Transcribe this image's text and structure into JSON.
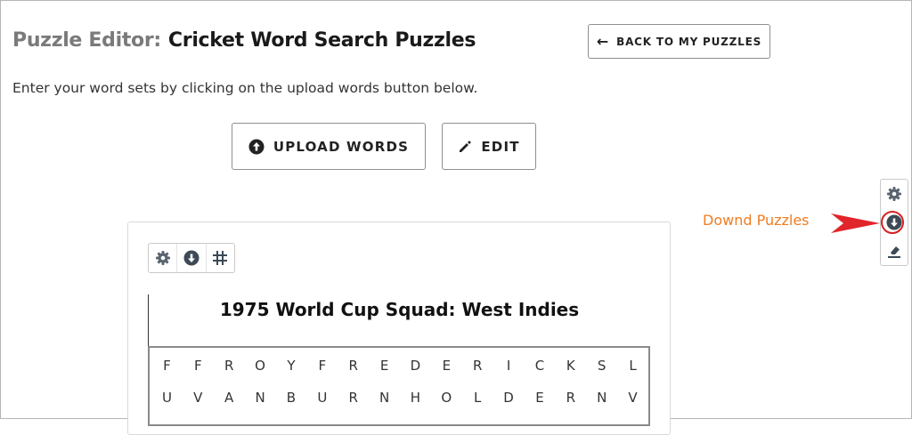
{
  "header": {
    "title_prefix": "Puzzle Editor:",
    "title": "Cricket Word Search Puzzles",
    "back_button": "BACK TO MY PUZZLES"
  },
  "instruction": "Enter your word sets by clicking on the upload words button below.",
  "actions": {
    "upload_label": "UPLOAD WORDS",
    "edit_label": "EDIT"
  },
  "side_toolbar": {
    "icons": [
      "gear-icon",
      "download-icon",
      "eraser-icon"
    ]
  },
  "annotation": {
    "label": "Downd Puzzles",
    "color": "#ef7d22",
    "circle_color": "#d62020"
  },
  "puzzle": {
    "toolbar_icons": [
      "gear-icon",
      "download-icon",
      "grid-icon"
    ],
    "title": "1975 World Cup Squad: West Indies",
    "grid": [
      [
        "F",
        "F",
        "R",
        "O",
        "Y",
        "F",
        "R",
        "E",
        "D",
        "E",
        "R",
        "I",
        "C",
        "K",
        "S",
        "L"
      ],
      [
        "U",
        "V",
        "A",
        "N",
        "B",
        "U",
        "R",
        "N",
        "H",
        "O",
        "L",
        "D",
        "E",
        "R",
        "N",
        "V"
      ]
    ]
  }
}
